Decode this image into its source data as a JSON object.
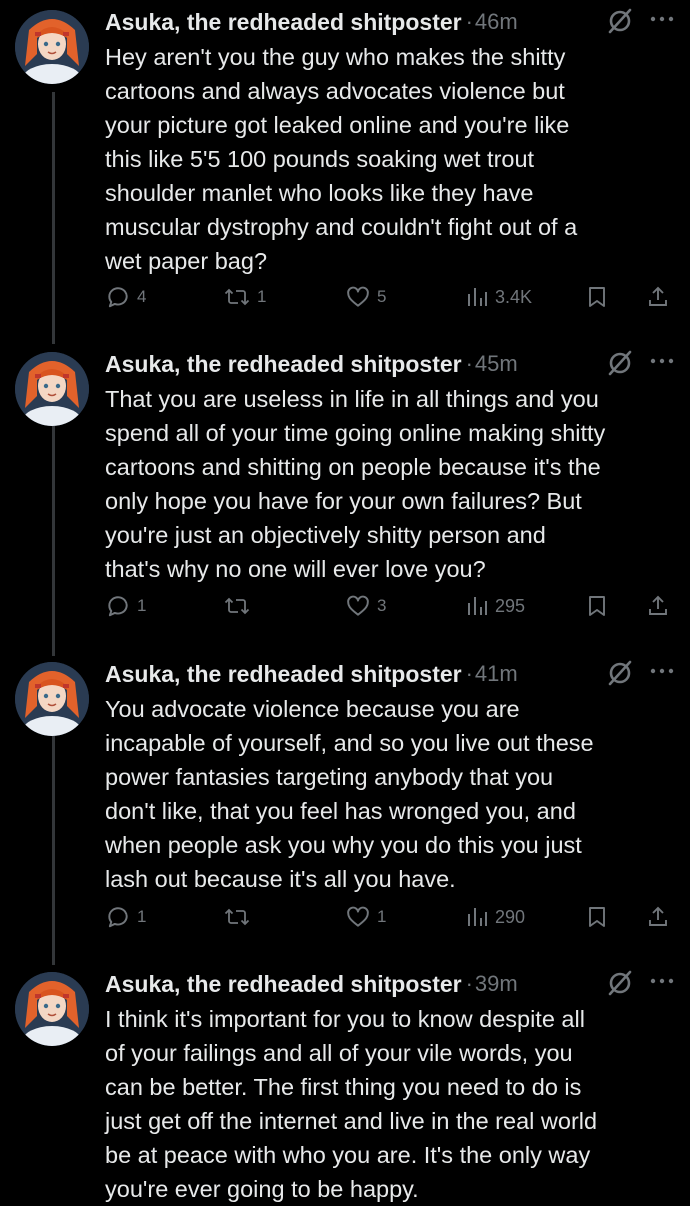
{
  "thread": {
    "author_name": "Asuka, the redheaded shitposter",
    "posts": [
      {
        "time": "46m",
        "text": "Hey aren't you the guy who makes the shitty\ncartoons and always advocates violence but\nyour picture got leaked online and you're like\nthis like 5'5 100 pounds soaking wet trout\nshoulder manlet who looks like they have\nmuscular dystrophy and couldn't fight out of a\nwet paper bag?",
        "replies": "4",
        "reposts": "1",
        "likes": "5",
        "views": "3.4K"
      },
      {
        "time": "45m",
        "text": "That you are useless in life in all things and you\nspend all of your time going online making shitty\ncartoons and shitting on people because it's the\nonly hope you have for your own failures? But\nyou're just an objectively shitty person and\nthat's why no one will ever love you?",
        "replies": "1",
        "reposts": "",
        "likes": "3",
        "views": "295"
      },
      {
        "time": "41m",
        "text": "You advocate violence because you are\nincapable of yourself, and so you live out these\npower fantasies targeting anybody that you\ndon't like, that you feel has wronged you, and\nwhen people ask you why you do this you just\nlash out because it's all you have.",
        "replies": "1",
        "reposts": "",
        "likes": "1",
        "views": "290"
      },
      {
        "time": "39m",
        "text": "I think it's important for you to know despite all\nof your failings and all of your vile words, you\ncan be better. The first thing you need to do is\njust get off the internet and live in the real world\nbe at peace with who you are. It's the only way\nyou're ever going to be happy.",
        "replies": "",
        "reposts": "",
        "likes": "",
        "views": ""
      }
    ]
  },
  "ui": {
    "separator": "·",
    "icons": {
      "reply": "speech-bubble-icon",
      "repost": "repost-arrows-icon",
      "like": "heart-icon",
      "views": "bar-chart-icon",
      "bookmark": "bookmark-icon",
      "share": "share-upload-icon",
      "grok": "grok-slash-icon",
      "more": "ellipsis-icon"
    },
    "colors": {
      "background": "#000000",
      "primary_text": "#e7e9ea",
      "secondary_text": "#71767b",
      "thread_line": "#333639"
    }
  }
}
